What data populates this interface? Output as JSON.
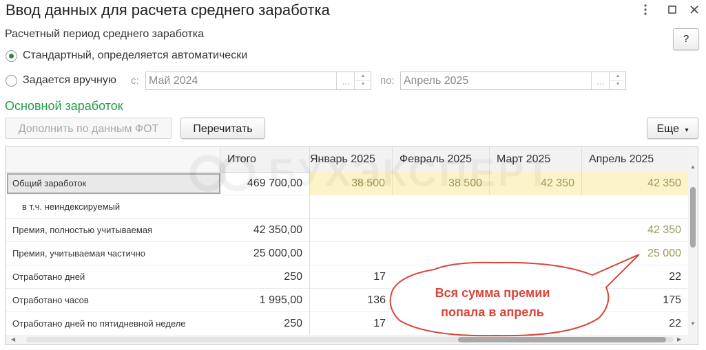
{
  "window": {
    "title": "Ввод данных для расчета среднего заработка",
    "help_label": "?"
  },
  "period": {
    "heading": "Расчетный период среднего заработка",
    "option_standard": "Стандартный, определяется автоматически",
    "option_manual": "Задается вручную",
    "from_label": "с:",
    "from_value": "Май 2024",
    "to_label": "по:",
    "to_value": "Апрель 2025",
    "select_label": "...",
    "spin_up": "▲",
    "spin_down": "▼"
  },
  "section_title": "Основной заработок",
  "toolbar": {
    "fill_label": "Дополнить по данным ФОТ",
    "recalc_label": "Перечитать",
    "more_label": "Еще",
    "more_arrow": "▾"
  },
  "table": {
    "columns": [
      "Итого",
      "Январь 2025",
      "Февраль 2025",
      "Март 2025",
      "Апрель 2025"
    ],
    "rows": [
      {
        "name": "Общий заработок",
        "total": "469 700,00",
        "jan": "38 500",
        "feb": "38 500",
        "mar": "42 350",
        "apr": "42 350"
      },
      {
        "name": "в т.ч. неиндексируемый",
        "total": "",
        "jan": "",
        "feb": "",
        "mar": "",
        "apr": ""
      },
      {
        "name": "Премия, полностью учитываемая",
        "total": "42 350,00",
        "jan": "",
        "feb": "",
        "mar": "",
        "apr": "42 350"
      },
      {
        "name": "Премия, учитываемая частично",
        "total": "25 000,00",
        "jan": "",
        "feb": "",
        "mar": "",
        "apr": "25 000"
      },
      {
        "name": "Отработано дней",
        "total": "250",
        "jan": "17",
        "feb": "",
        "mar": "",
        "apr": "22"
      },
      {
        "name": "Отработано часов",
        "total": "1 995,00",
        "jan": "136",
        "feb": "",
        "mar": "",
        "apr": "175"
      },
      {
        "name": "Отработано дней по пятидневной неделе",
        "total": "250",
        "jan": "17",
        "feb": "",
        "mar": "",
        "apr": "22"
      }
    ]
  },
  "scroll": {
    "up": "▲",
    "down": "▼",
    "left": "◀",
    "right": "▶"
  },
  "watermark": "БУХЭКСПЕРТ",
  "callout": {
    "line1": "Вся сумма премии",
    "line2": "попала в апрель"
  },
  "colors": {
    "accent_green": "#1e9e4a",
    "highlight_yellow": "#fcf3c8",
    "callout_red": "#d9443a"
  }
}
